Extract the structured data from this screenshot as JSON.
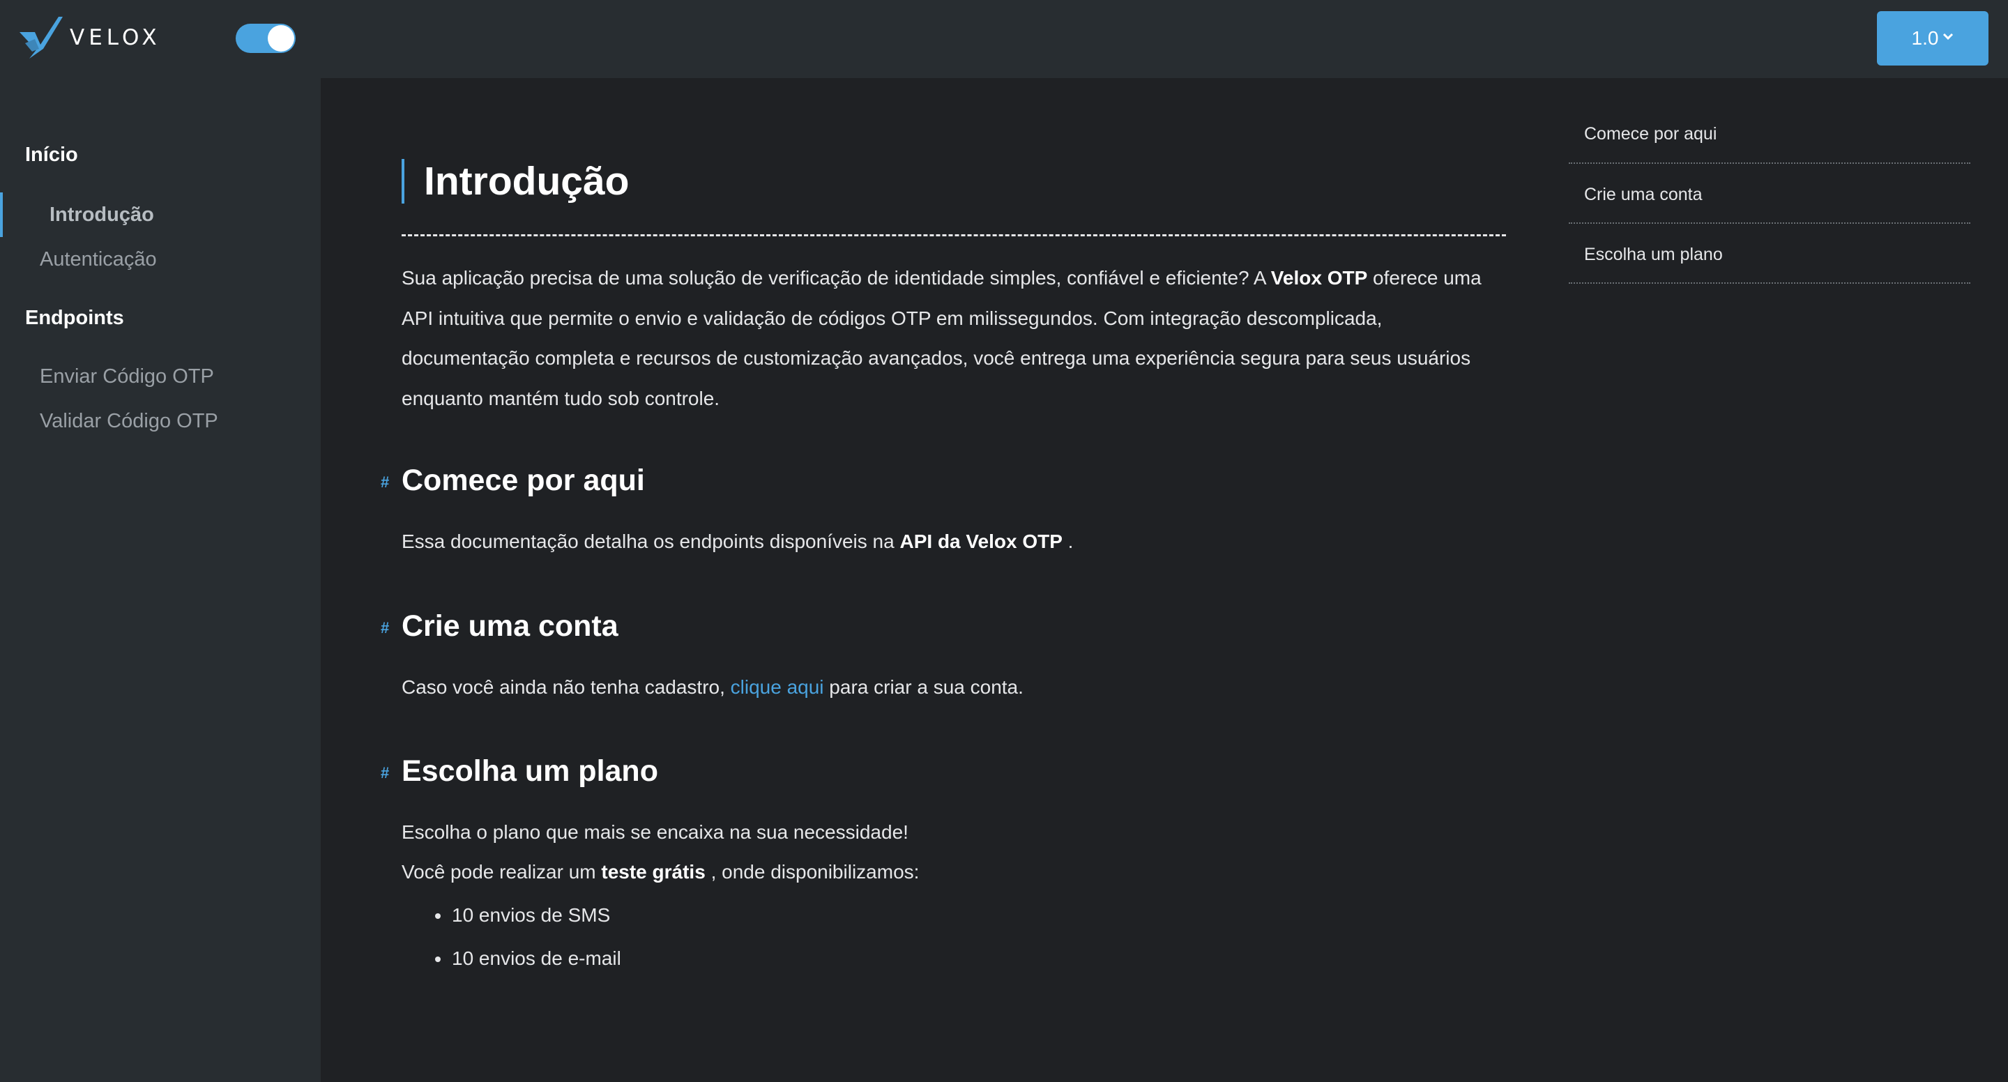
{
  "header": {
    "logo_text": "VELOX",
    "theme_toggle_on": true,
    "version_label": "1.0",
    "accent_color": "#4aa3df"
  },
  "sidebar": {
    "sections": [
      {
        "title": "Início",
        "items": [
          {
            "label": "Introdução",
            "active": true
          },
          {
            "label": "Autenticação",
            "active": false
          }
        ]
      },
      {
        "title": "Endpoints",
        "items": [
          {
            "label": "Enviar Código OTP",
            "active": false
          },
          {
            "label": "Validar Código OTP",
            "active": false
          }
        ]
      }
    ]
  },
  "main": {
    "title": "Introdução",
    "intro": {
      "part1": "Sua aplicação precisa de uma solução de verificação de identidade simples, confiável e eficiente? A ",
      "bold": "Velox OTP",
      "part2": " oferece uma API intuitiva que permite o envio e validação de códigos OTP em milissegundos. Com integração descomplicada, documentação completa e recursos de customização avançados, você entrega uma experiência segura para seus usuários enquanto mantém tudo sob controle."
    },
    "sections": [
      {
        "heading": "Comece por aqui",
        "text_before": "Essa documentação detalha os endpoints disponíveis na ",
        "bold": "API da Velox OTP",
        "text_after": " ."
      },
      {
        "heading": "Crie uma conta",
        "text_before": "Caso você ainda não tenha cadastro, ",
        "link": "clique aqui",
        "text_after": " para criar a sua conta."
      },
      {
        "heading": "Escolha um plano",
        "line1": "Escolha o plano que mais se encaixa na sua necessidade!",
        "line2_before": "Você pode realizar um ",
        "line2_bold": "teste grátis",
        "line2_after": " , onde disponibilizamos:",
        "bullets": [
          "10 envios de SMS",
          "10 envios de e-mail"
        ]
      }
    ],
    "heading_anchor": "#"
  },
  "toc": {
    "items": [
      "Comece por aqui",
      "Crie uma conta",
      "Escolha um plano"
    ]
  }
}
